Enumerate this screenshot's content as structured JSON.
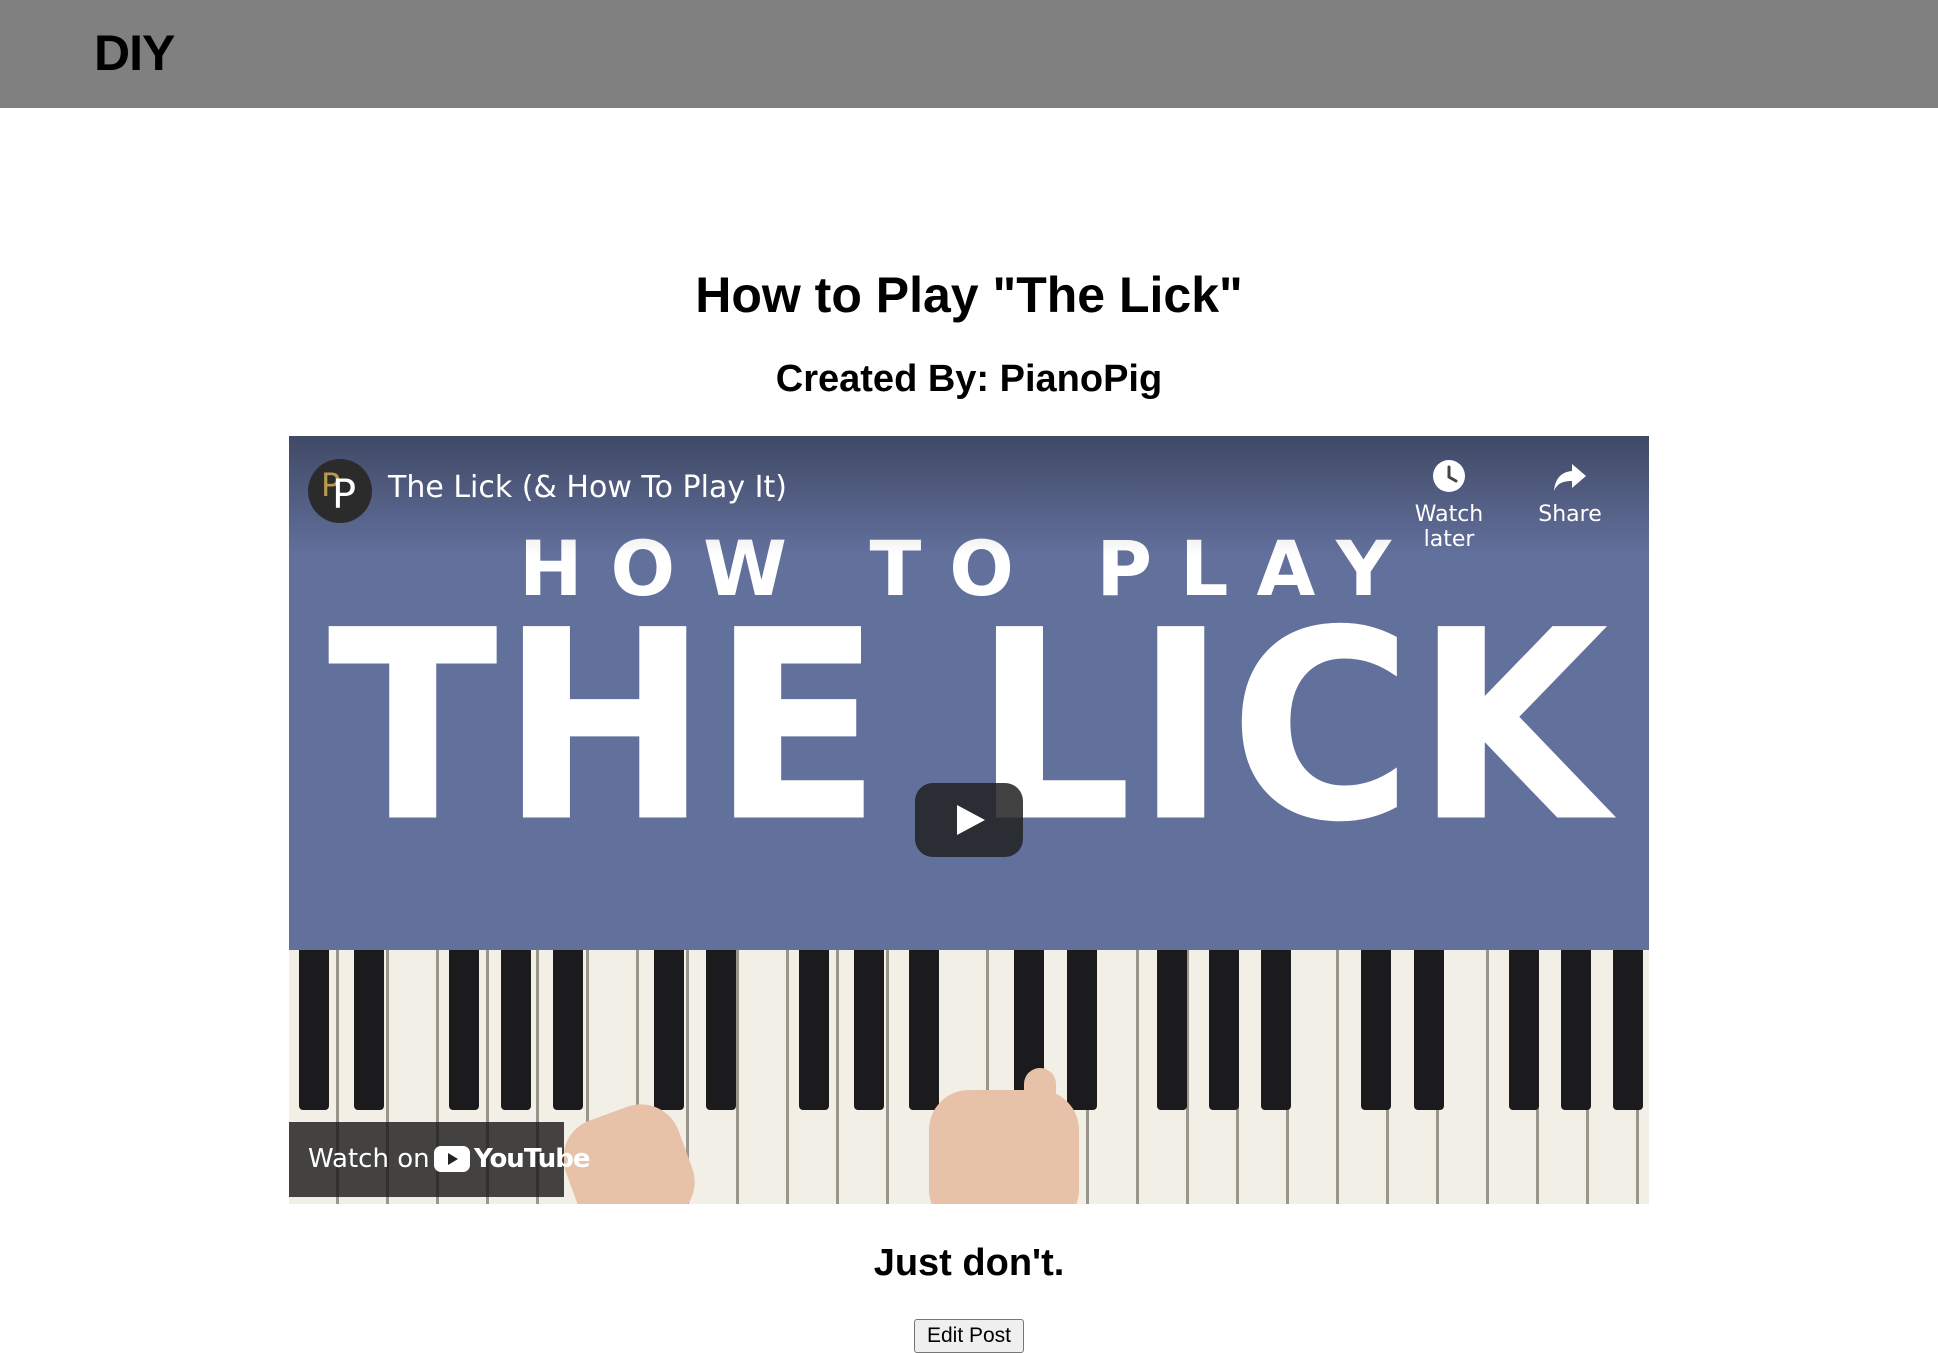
{
  "header": {
    "logo": "DIY"
  },
  "post": {
    "title": "How to Play \"The Lick\"",
    "author_line": "Created By: PianoPig",
    "body": "Just don't.",
    "edit_label": "Edit Post"
  },
  "video": {
    "title": "The Lick (& How To Play It)",
    "channel_avatar_text": "PP",
    "watch_later_label": "Watch later",
    "share_label": "Share",
    "thumbnail_line1": "HOW TO PLAY",
    "thumbnail_line2": "THE LICK",
    "watch_on_label": "Watch on",
    "youtube_label": "YouTube",
    "icons": [
      "clock-icon",
      "share-arrow-icon",
      "play-icon",
      "youtube-logo-icon"
    ],
    "colors": {
      "thumbnail_bg": "#62709c",
      "header_bg": "#808080"
    }
  }
}
